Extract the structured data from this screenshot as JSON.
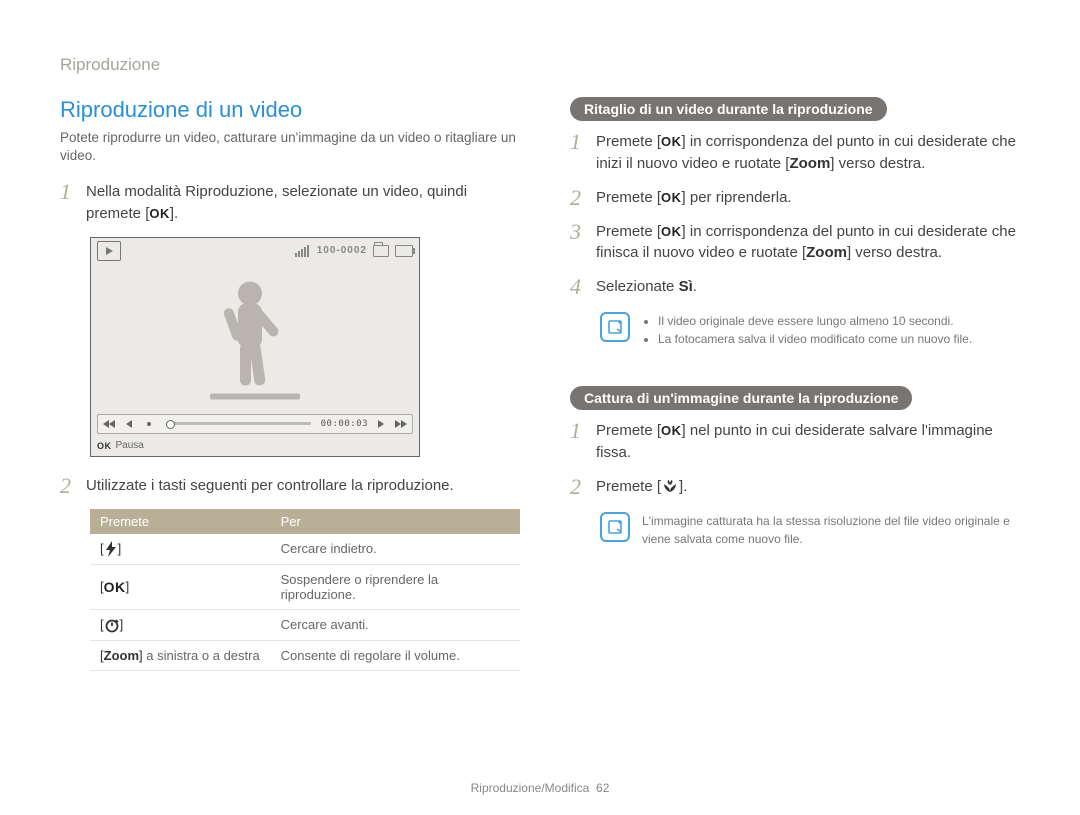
{
  "breadcrumb": "Riproduzione",
  "left": {
    "heading": "Riproduzione di un video",
    "intro": "Potete riprodurre un video, catturare un'immagine da un video o ritagliare un video.",
    "step1_a": "Nella modalità Riproduzione, selezionate un video, quindi premete [",
    "step1_b": "].",
    "screen": {
      "counter": "100-0002",
      "time": "00:00:03",
      "ok": "OK",
      "pause": "Pausa"
    },
    "step2": "Utilizzate i tasti seguenti per controllare la riproduzione.",
    "table": {
      "h1": "Premete",
      "h2": "Per",
      "rows": [
        {
          "key_pre": "[",
          "key_post": "]",
          "desc": "Cercare indietro."
        },
        {
          "key_pre": "[",
          "key_post": "]",
          "desc": "Sospendere o riprendere la riproduzione."
        },
        {
          "key_pre": "[",
          "key_post": "]",
          "desc": "Cercare avanti."
        },
        {
          "key_text": "[Zoom] a sinistra o a destra",
          "desc": "Consente di regolare il volume."
        }
      ]
    }
  },
  "right": {
    "pill1": "Ritaglio di un video durante la riproduzione",
    "t1": {
      "s1a": "Premete [",
      "s1b": "] in corrispondenza del punto in cui desiderate che inizi il nuovo video e ruotate [",
      "s1c": "Zoom",
      "s1d": "] verso destra.",
      "s2a": "Premete [",
      "s2b": "] per riprenderla.",
      "s3a": "Premete [",
      "s3b": "] in corrispondenza del punto in cui desiderate che finisca il nuovo video e ruotate [",
      "s3c": "Zoom",
      "s3d": "] verso destra.",
      "s4a": "Selezionate ",
      "s4b": "Sì",
      "s4c": "."
    },
    "note1a": "Il video originale deve essere lungo almeno 10 secondi.",
    "note1b": "La fotocamera salva il video modificato come un nuovo file.",
    "pill2": "Cattura di un'immagine durante la riproduzione",
    "c1a": "Premete [",
    "c1b": "] nel punto in cui desiderate salvare l'immagine fissa.",
    "c2a": "Premete [",
    "c2b": "].",
    "note2": "L'immagine catturata ha la stessa risoluzione del file video originale e viene salvata come nuovo file."
  },
  "footer_a": "Riproduzione/Modifica",
  "footer_b": "62",
  "ok_label": "OK"
}
